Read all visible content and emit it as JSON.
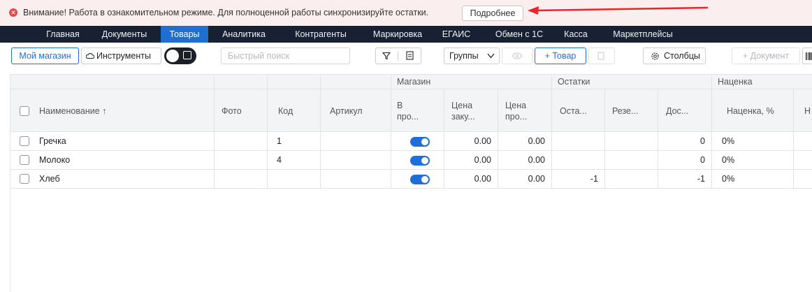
{
  "banner": {
    "text": "Внимание! Работа в ознакомительном режиме. Для полноценной работы синхронизируйте остатки.",
    "button": "Подробнее",
    "icon": "close-circle-icon",
    "accent": "#e04a4a"
  },
  "nav": {
    "items": [
      "Главная",
      "Документы",
      "Товары",
      "Аналитика",
      "Контрагенты",
      "Маркировка",
      "ЕГАИС",
      "Обмен с 1С",
      "Касса",
      "Маркетплейсы"
    ],
    "active": "Товары"
  },
  "toolbar": {
    "store": "Мой магазин",
    "tools": "Инструменты",
    "search_placeholder": "Быстрый поиск",
    "groups": "Группы",
    "add_product": "+ Товар",
    "columns": "Столбцы",
    "add_document": "+ Документ"
  },
  "table": {
    "groups": {
      "store": "Магазин",
      "stock": "Остатки",
      "markup": "Наценка"
    },
    "headers": {
      "name": "Наименование ↑",
      "photo": "Фото",
      "code": "Код",
      "article": "Артикул",
      "on_sale_1": "В",
      "on_sale_2": "про...",
      "buy_price_1": "Цена",
      "buy_price_2": "заку...",
      "sell_price_1": "Цена",
      "sell_price_2": "про...",
      "remain": "Оста...",
      "reserve": "Резе...",
      "available": "Дос...",
      "markup_pct": "Наценка, %",
      "extra": "Н"
    },
    "rows": [
      {
        "name": "Гречка",
        "code": "1",
        "buy": "0.00",
        "sell": "0.00",
        "remain": "",
        "available": "0",
        "markup": "0%"
      },
      {
        "name": "Молоко",
        "code": "4",
        "buy": "0.00",
        "sell": "0.00",
        "remain": "",
        "available": "0",
        "markup": "0%"
      },
      {
        "name": "Хлеб",
        "code": "",
        "buy": "0.00",
        "sell": "0.00",
        "remain": "-1",
        "available": "-1",
        "markup": "0%"
      }
    ]
  }
}
